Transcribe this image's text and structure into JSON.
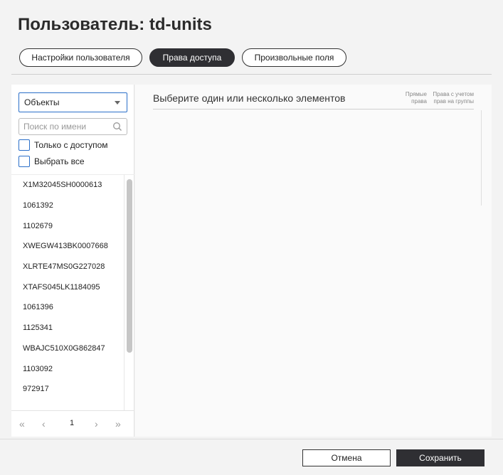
{
  "dialog": {
    "title": "Пользователь: td-units"
  },
  "tabs": [
    {
      "label": "Настройки пользователя"
    },
    {
      "label": "Права доступа",
      "active": true
    },
    {
      "label": "Произвольные поля"
    }
  ],
  "left": {
    "select_value": "Объекты",
    "search_placeholder": "Поиск по имени",
    "only_access_label": "Только с доступом",
    "select_all_label": "Выбрать все",
    "items": [
      "X1M32045SH0000613",
      "1061392",
      "1102679",
      "XWEGW413BK0007668",
      "XLRTE47MS0G227028",
      "XTAFS045LK1184095",
      "1061396",
      "1125341",
      "WBAJC510X0G862847",
      "1103092",
      "972917"
    ],
    "pagination": {
      "current_page": "1"
    }
  },
  "right": {
    "title": "Выберите один или несколько элементов",
    "col_direct": "Прямые права",
    "col_group": "Права с учетом прав на группы"
  },
  "footer": {
    "cancel_label": "Отмена",
    "save_label": "Сохранить"
  },
  "colors": {
    "accent": "#2b6fc9",
    "dark": "#2f2f33",
    "background": "#f3f3f3"
  },
  "icons": [
    "search-icon",
    "first-page-icon",
    "prev-page-icon",
    "next-page-icon",
    "last-page-icon",
    "chevron-down-icon"
  ]
}
